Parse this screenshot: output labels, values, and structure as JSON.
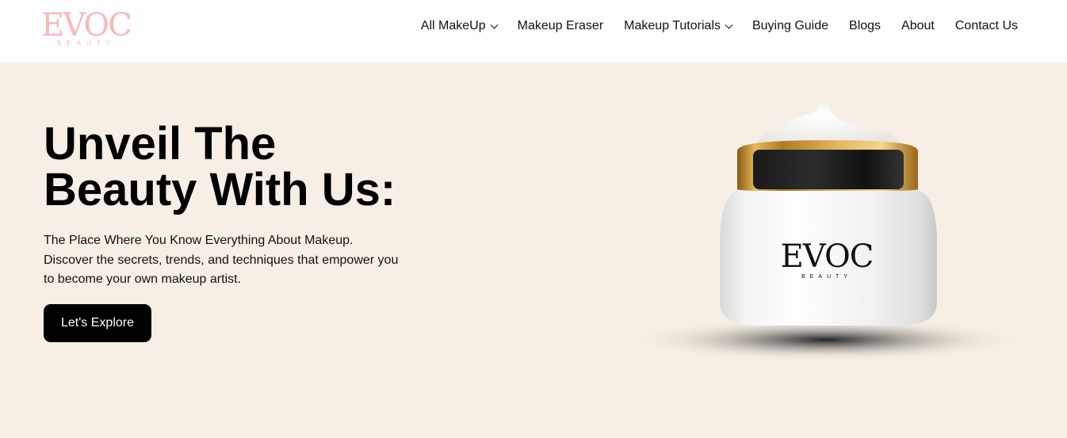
{
  "header": {
    "logo": {
      "main": "EVOC",
      "sub": "BEAUTY"
    },
    "nav": [
      {
        "label": "All MakeUp",
        "has_dropdown": true
      },
      {
        "label": "Makeup Eraser",
        "has_dropdown": false
      },
      {
        "label": "Makeup Tutorials",
        "has_dropdown": true
      },
      {
        "label": "Buying Guide",
        "has_dropdown": false
      },
      {
        "label": "Blogs",
        "has_dropdown": false
      },
      {
        "label": "About",
        "has_dropdown": false
      },
      {
        "label": "Contact Us",
        "has_dropdown": false
      }
    ]
  },
  "hero": {
    "title_line1": "Unveil The",
    "title_line2": "Beauty With Us:",
    "desc_line1": "The Place Where You Know Everything About Makeup.",
    "desc_line2": "Discover the secrets, trends, and techniques that empower you",
    "desc_line3": "to become your own makeup artist.",
    "cta_label": "Let's Explore",
    "product_brand": "EVOC",
    "product_sub": "BEAUTY"
  },
  "colors": {
    "hero_bg": "#f7efe5",
    "logo_pink": "#f6b9b9",
    "button_bg": "#000000",
    "jar_lid_gold": "#c8952f"
  },
  "icons": [
    "chevron-down-icon"
  ]
}
